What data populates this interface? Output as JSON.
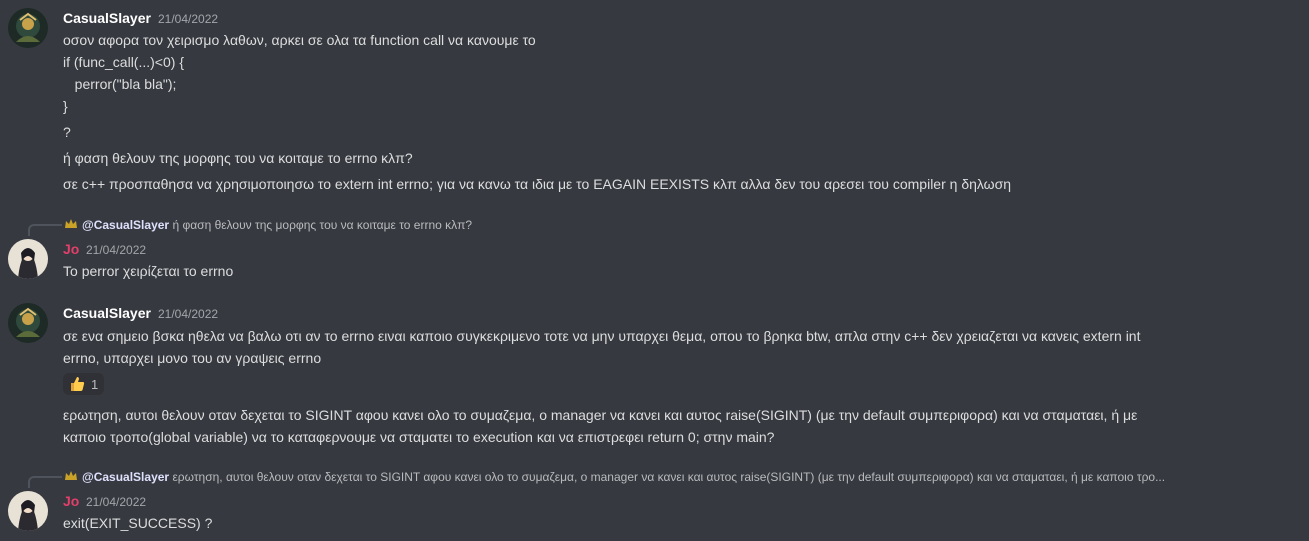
{
  "colors": {
    "background": "#36393f",
    "text": "#dcddde",
    "casual_name": "#ffffff",
    "jo_name": "#e23f6a",
    "timestamp": "#a3a6aa"
  },
  "messages": [
    {
      "author": "CasualSlayer",
      "timestamp": "21/04/2022",
      "lines": [
        "οσον αφορα τον χειρισμο λαθων, αρκει σε ολα τα function call να κανουμε το",
        "if (func_call(...)<0) {",
        "   perror(\"bla bla\");",
        "}",
        "?",
        "ή φαση θελουν της μορφης του να κοιταμε το errno κλπ?",
        "σε c++ προσπαθησα να χρησιμοποιησω το extern int errno; για να κανω τα ιδια με το EAGAIN EEXISTS κλπ αλλα δεν του αρεσει του compiler η δηλωση"
      ]
    },
    {
      "reply_to": {
        "mention": "@CasualSlayer",
        "text": "ή φαση θελουν της μορφης του να κοιταμε το errno κλπ?"
      },
      "author": "Jo",
      "timestamp": "21/04/2022",
      "lines": [
        "Το perror χειρίζεται το errno"
      ]
    },
    {
      "author": "CasualSlayer",
      "timestamp": "21/04/2022",
      "lines": [
        "σε ενα σημειο βσκα ηθελα να βαλω οτι αν το errno ειναι καποιο συγκεκριμενο τοτε να μην υπαρχει θεμα, οπου το βρηκα btw, απλα στην c++ δεν χρειαζεται να κανεις extern int",
        "errno, υπαρχει μονο του αν γραψεις errno"
      ],
      "reaction": {
        "icon": "thumbs-up-icon",
        "count": "1"
      },
      "lines_after": [
        "ερωτηση, αυτοι θελουν οταν δεχεται το SIGINT αφου κανει ολο το συμαζεμα, ο manager να κανει και αυτος raise(SIGINT) (με την default συμπεριφορα) και να σταματαει, ή με",
        "καποιο τροπο(global variable) να το καταφερνουμε να σταματει το execution και να επιστρεφει return 0; στην main?"
      ]
    },
    {
      "reply_to": {
        "mention": "@CasualSlayer",
        "text": "ερωτηση, αυτοι θελουν οταν δεχεται το SIGINT αφου κανει ολο το συμαζεμα, ο manager να κανει και αυτος raise(SIGINT) (με την default συμπεριφορα) και να σταματαει, ή με καποιο τρο..."
      },
      "author": "Jo",
      "timestamp": "21/04/2022",
      "lines": [
        "exit(EXIT_SUCCESS) ?"
      ]
    }
  ]
}
